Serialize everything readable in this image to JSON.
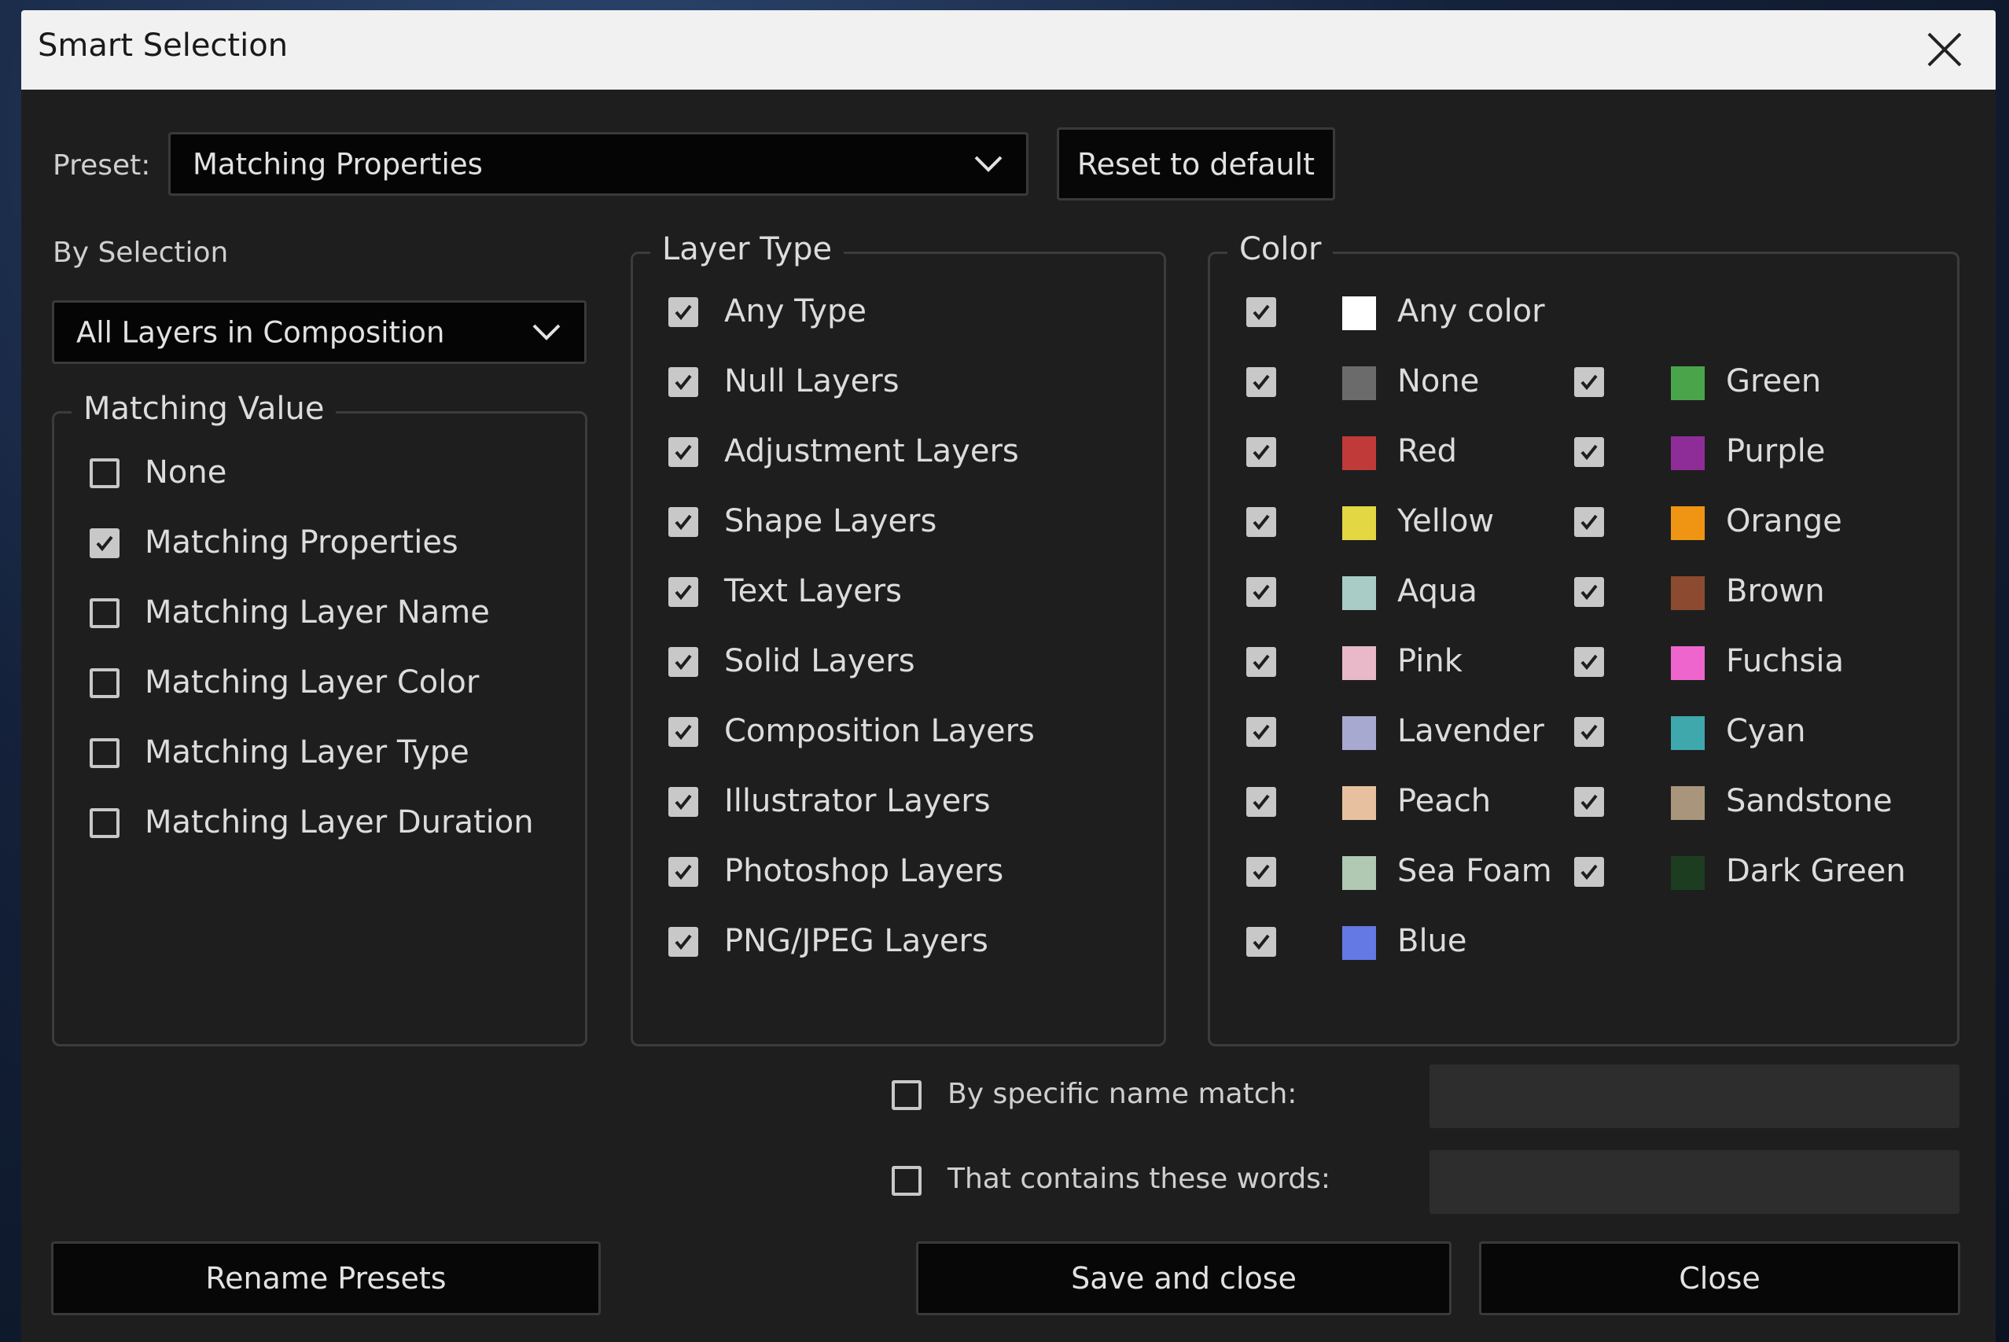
{
  "dialog": {
    "title": "Smart Selection"
  },
  "preset": {
    "label": "Preset:",
    "selected": "Matching Properties",
    "reset_label": "Reset to default"
  },
  "by_selection": {
    "label": "By Selection",
    "selected": "All Layers in Composition"
  },
  "matching_value": {
    "legend": "Matching Value",
    "options": [
      {
        "label": "None",
        "checked": false
      },
      {
        "label": "Matching Properties",
        "checked": true
      },
      {
        "label": "Matching Layer Name",
        "checked": false
      },
      {
        "label": "Matching Layer Color",
        "checked": false
      },
      {
        "label": "Matching Layer Type",
        "checked": false
      },
      {
        "label": "Matching Layer Duration",
        "checked": false
      }
    ]
  },
  "layer_type": {
    "legend": "Layer Type",
    "options": [
      {
        "label": "Any Type",
        "checked": true
      },
      {
        "label": "Null Layers",
        "checked": true
      },
      {
        "label": "Adjustment Layers",
        "checked": true
      },
      {
        "label": "Shape Layers",
        "checked": true
      },
      {
        "label": "Text Layers",
        "checked": true
      },
      {
        "label": "Solid Layers",
        "checked": true
      },
      {
        "label": "Composition Layers",
        "checked": true
      },
      {
        "label": "Illustrator Layers",
        "checked": true
      },
      {
        "label": "Photoshop Layers",
        "checked": true
      },
      {
        "label": "PNG/JPEG Layers",
        "checked": true
      }
    ]
  },
  "color": {
    "legend": "Color",
    "any": {
      "label": "Any color",
      "color": "#ffffff",
      "checked": true
    },
    "left": [
      {
        "label": "None",
        "color": "#6b6b6b",
        "checked": true
      },
      {
        "label": "Red",
        "color": "#c03a3a",
        "checked": true
      },
      {
        "label": "Yellow",
        "color": "#e3d744",
        "checked": true
      },
      {
        "label": "Aqua",
        "color": "#a9cdc6",
        "checked": true
      },
      {
        "label": "Pink",
        "color": "#e9b9c9",
        "checked": true
      },
      {
        "label": "Lavender",
        "color": "#a8a9d0",
        "checked": true
      },
      {
        "label": "Peach",
        "color": "#e7c19f",
        "checked": true
      },
      {
        "label": "Sea Foam",
        "color": "#b1c8b2",
        "checked": true
      },
      {
        "label": "Blue",
        "color": "#6479e4",
        "checked": true
      }
    ],
    "right": [
      {
        "label": "Green",
        "color": "#4aa54a",
        "checked": true
      },
      {
        "label": "Purple",
        "color": "#8e2d98",
        "checked": true
      },
      {
        "label": "Orange",
        "color": "#ef9513",
        "checked": true
      },
      {
        "label": "Brown",
        "color": "#8c4a30",
        "checked": true
      },
      {
        "label": "Fuchsia",
        "color": "#ee66cd",
        "checked": true
      },
      {
        "label": "Cyan",
        "color": "#3ea8ad",
        "checked": true
      },
      {
        "label": "Sandstone",
        "color": "#a8957b",
        "checked": true
      },
      {
        "label": "Dark Green",
        "color": "#1d3d20",
        "checked": true
      }
    ]
  },
  "name_match": {
    "specific_label": "By specific name match:",
    "specific_checked": false,
    "specific_value": "",
    "contains_label": "That contains these words:",
    "contains_checked": false,
    "contains_value": ""
  },
  "footer": {
    "rename_label": "Rename Presets",
    "save_label": "Save and close",
    "close_label": "Close"
  }
}
